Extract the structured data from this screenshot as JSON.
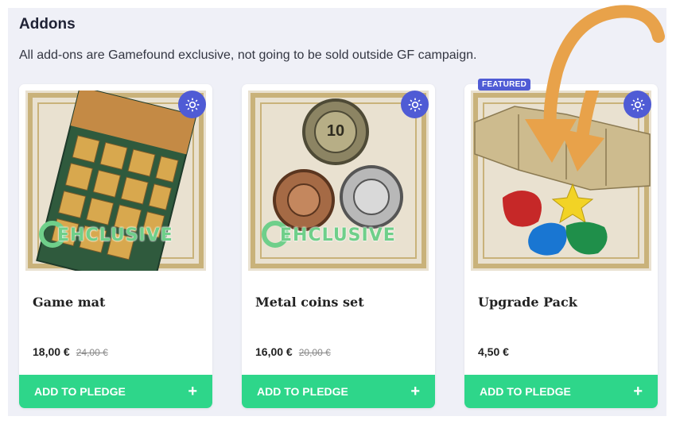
{
  "section": {
    "title": "Addons",
    "subtitle": "All add-ons are Gamefound exclusive, not going to be sold outside GF campaign."
  },
  "cards": [
    {
      "name": "Game mat",
      "price": "18,00 €",
      "old_price": "24,00 €",
      "button": "ADD TO PLEDGE",
      "plus": "+",
      "badge": "",
      "image_text": "EHCLUSIVE",
      "image": "game-mat-image",
      "icon": "gear-icon"
    },
    {
      "name": "Metal coins set",
      "price": "16,00 €",
      "old_price": "20,00 €",
      "button": "ADD TO PLEDGE",
      "plus": "+",
      "badge": "",
      "image_text": "EHCLUSIVE",
      "coin_text": "10",
      "image": "metal-coins-image",
      "icon": "gear-icon"
    },
    {
      "name": "Upgrade Pack",
      "price": "4,50 €",
      "old_price": "",
      "button": "ADD TO PLEDGE",
      "plus": "+",
      "badge": "FEATURED",
      "image": "upgrade-pack-image",
      "icon": "gear-icon"
    }
  ],
  "colors": {
    "accent": "#4f5bd5",
    "button": "#2ed68a",
    "background": "#eff0f7",
    "arrow": "#e8a24a"
  }
}
